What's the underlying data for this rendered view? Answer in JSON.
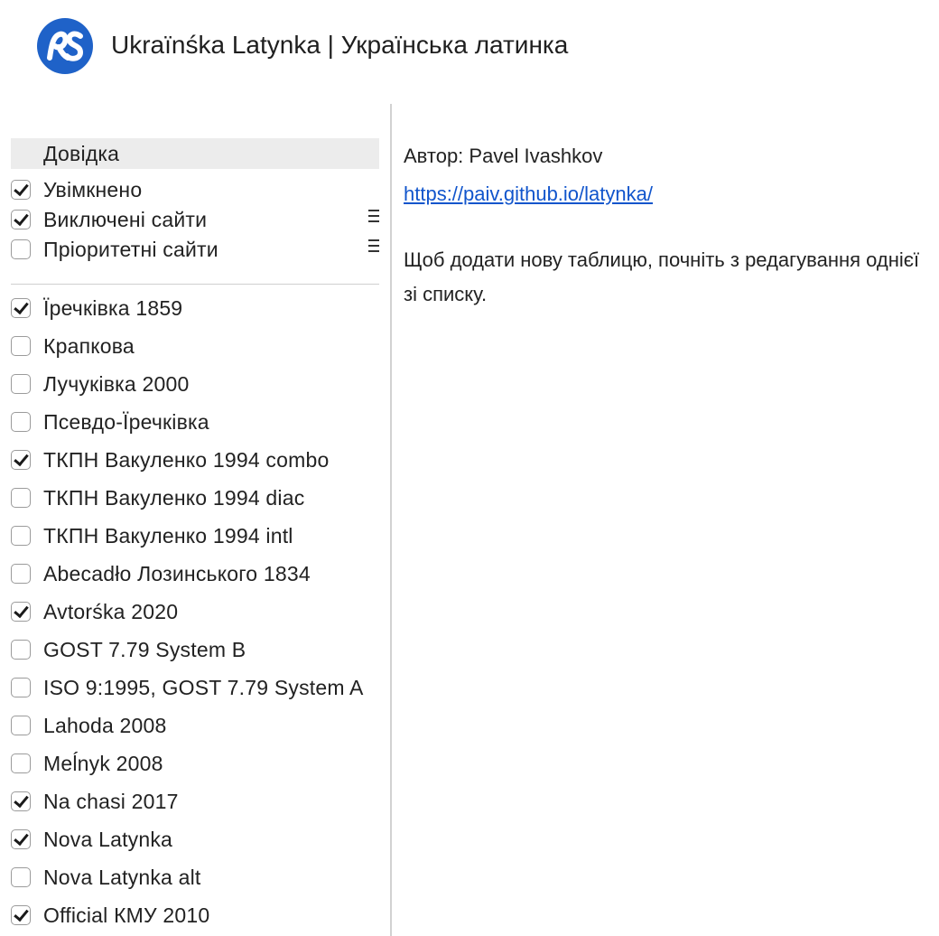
{
  "header": {
    "title": "Ukraïnśka Latynka | Українська латинка",
    "logo_color": "#1f62c8"
  },
  "sidebar": {
    "help_label": "Довідка",
    "settings": [
      {
        "label": "Увімкнено",
        "checked": true,
        "menu": false
      },
      {
        "label": "Виключені сайти",
        "checked": true,
        "menu": true
      },
      {
        "label": "Пріоритетні сайти",
        "checked": false,
        "menu": true
      }
    ],
    "tables": [
      {
        "label": "Їречківка 1859",
        "checked": true
      },
      {
        "label": "Крапкова",
        "checked": false
      },
      {
        "label": "Лучуківка 2000",
        "checked": false
      },
      {
        "label": "Псевдо-Їречківка",
        "checked": false
      },
      {
        "label": "ТКПН Вакуленко 1994 combo",
        "checked": true
      },
      {
        "label": "ТКПН Вакуленко 1994 diac",
        "checked": false
      },
      {
        "label": "ТКПН Вакуленко 1994 intl",
        "checked": false
      },
      {
        "label": "Abecadło Лозинського 1834",
        "checked": false
      },
      {
        "label": "Avtorśka 2020",
        "checked": true
      },
      {
        "label": "GOST 7.79 System B",
        "checked": false
      },
      {
        "label": "ISO 9:1995, GOST 7.79 System A",
        "checked": false
      },
      {
        "label": "Lahoda 2008",
        "checked": false
      },
      {
        "label": "Meĺnyk 2008",
        "checked": false
      },
      {
        "label": "Na chasi 2017",
        "checked": true
      },
      {
        "label": "Nova Latynka",
        "checked": true
      },
      {
        "label": "Nova Latynka alt",
        "checked": false
      },
      {
        "label": "Official КМУ 2010",
        "checked": true
      }
    ]
  },
  "content": {
    "author": "Автор: Pavel Ivashkov",
    "link": "https://paiv.github.io/latynka/",
    "description": "Щоб додати нову таблицю, почніть з редагування однієї зі списку."
  }
}
